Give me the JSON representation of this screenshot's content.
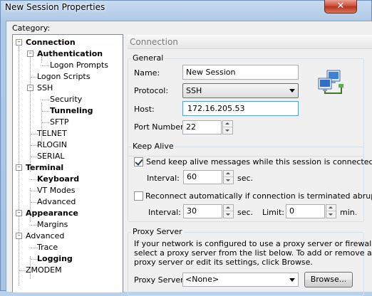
{
  "window": {
    "title": "New Session Properties",
    "close_glyph": "✕"
  },
  "category_label": "Category:",
  "tree": {
    "connection": "Connection",
    "authentication": "Authentication",
    "logon_prompts": "Logon Prompts",
    "logon_scripts": "Logon Scripts",
    "ssh": "SSH",
    "security": "Security",
    "tunneling": "Tunneling",
    "sftp": "SFTP",
    "telnet": "TELNET",
    "rlogin": "RLOGIN",
    "serial": "SERIAL",
    "terminal": "Terminal",
    "keyboard": "Keyboard",
    "vt_modes": "VT Modes",
    "advanced_term": "Advanced",
    "appearance": "Appearance",
    "margins": "Margins",
    "advanced": "Advanced",
    "trace": "Trace",
    "logging": "Logging",
    "zmodem": "ZMODEM"
  },
  "panel": {
    "header": "Connection"
  },
  "general": {
    "title": "General",
    "name_label": "Name:",
    "name_value": "New Session",
    "protocol_label": "Protocol:",
    "protocol_value": "SSH",
    "host_label": "Host:",
    "host_value": "172.16.205.53",
    "port_label": "Port Number:",
    "port_value": "22"
  },
  "keep_alive": {
    "title": "Keep Alive",
    "send_label": "Send keep alive messages while this session is connected",
    "send_checked": true,
    "interval_label": "Interval:",
    "interval_value": "60",
    "sec_label": "sec.",
    "reconnect_label": "Reconnect automatically if connection is terminated abruptly",
    "reconnect_checked": false,
    "reconnect_interval_label": "Interval:",
    "reconnect_interval_value": "30",
    "reconnect_sec_label": "sec.",
    "limit_label": "Limit:",
    "limit_value": "0",
    "min_label": "min."
  },
  "proxy": {
    "title": "Proxy Server",
    "description_line1": "If your network is configured to use a proxy server or firewall,",
    "description_line2": "select a proxy server from the list below. To add or remove a",
    "description_line3": "proxy server or edit its settings, click Browse.",
    "server_label": "Proxy Server:",
    "server_value": "<None>",
    "browse_label": "Browse..."
  },
  "colors": {
    "accent_focus": "#569de5",
    "title_close": "#c7462f"
  },
  "icons": {
    "network": "network-computers-icon",
    "expander_minus": "minus-expander-icon"
  }
}
